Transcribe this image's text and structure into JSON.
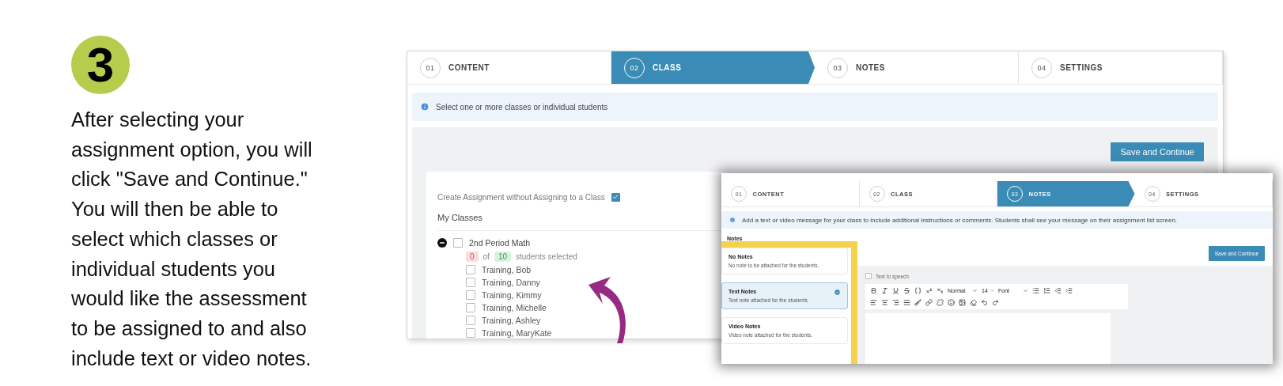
{
  "step_badge": "3",
  "instructions": "After selecting your\nassignment option, you will\nclick \"Save and Continue.\"\nYou will then be able to\nselect which classes or\nindividual students you\nwould like the assessment\nto be assigned to and also\ninclude text or video notes.",
  "class_screen": {
    "steps": [
      {
        "number": "01",
        "label": "CONTENT",
        "selected": false
      },
      {
        "number": "02",
        "label": "CLASS",
        "selected": true
      },
      {
        "number": "03",
        "label": "NOTES",
        "selected": false
      },
      {
        "number": "04",
        "label": "SETTINGS",
        "selected": false
      }
    ],
    "info": "Select one or more classes or individual students",
    "save_button": "Save and Continue",
    "create_without_class": {
      "label": "Create Assignment without Assigning to a Class",
      "checked": true
    },
    "section_title": "My Classes",
    "classes": [
      {
        "name": "2nd Period Math",
        "expanded": true,
        "checked": false,
        "selected_count": "0",
        "of": "of",
        "total": "10",
        "suffix": "students selected",
        "students": [
          {
            "name": "Training, Bob",
            "checked": false
          },
          {
            "name": "Training, Danny",
            "checked": false
          },
          {
            "name": "Training, Kimmy",
            "checked": false
          },
          {
            "name": "Training, Michelle",
            "checked": false
          },
          {
            "name": "Training, Ashley",
            "checked": false
          },
          {
            "name": "Training, MaryKate",
            "checked": false
          }
        ]
      }
    ]
  },
  "notes_screen": {
    "steps": [
      {
        "number": "01",
        "label": "CONTENT",
        "selected": false
      },
      {
        "number": "02",
        "label": "CLASS",
        "selected": false
      },
      {
        "number": "03",
        "label": "NOTES",
        "selected": true
      },
      {
        "number": "04",
        "label": "SETTINGS",
        "selected": false
      }
    ],
    "info": "Add a text or video message for your class to include additional instructions or comments. Students shall see your message on their assignment list screen.",
    "section_title": "Notes",
    "save_button": "Save and Continue",
    "note_types": [
      {
        "title": "No Notes",
        "description": "No note to be attached for the students.",
        "selected": false
      },
      {
        "title": "Text Notes",
        "description": "Text note attached for the students.",
        "selected": true
      },
      {
        "title": "Video Notes",
        "description": "Video note attached for the students.",
        "selected": false
      }
    ],
    "text_to_speech": {
      "label": "Text to speech",
      "checked": false
    },
    "editor": {
      "format": "Normal",
      "size": "14",
      "font": "Font"
    }
  }
}
